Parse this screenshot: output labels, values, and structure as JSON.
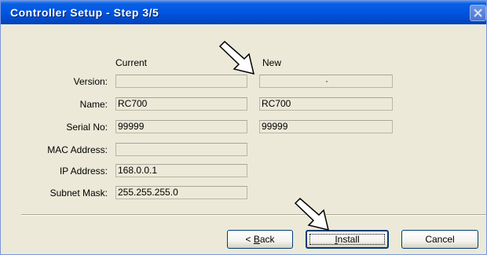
{
  "window": {
    "title": "Controller Setup - Step 3/5"
  },
  "headers": {
    "current": "Current",
    "new": "New"
  },
  "rows": [
    {
      "label": "Version:",
      "current": "",
      "new": "·"
    },
    {
      "label": "Name:",
      "current": "RC700",
      "new": "RC700"
    },
    {
      "label": "Serial No:",
      "current": "99999",
      "new": "99999"
    },
    {
      "label": "MAC Address:",
      "current": ""
    },
    {
      "label": "IP Address:",
      "current": "168.0.0.1"
    },
    {
      "label": "Subnet Mask:",
      "current": "255.255.255.0"
    }
  ],
  "buttons": {
    "back_prefix": "< ",
    "back_mnemonic": "B",
    "back_rest": "ack",
    "install_mnemonic": "I",
    "install_rest": "nstall",
    "cancel": "Cancel"
  },
  "icons": {
    "close": "close-icon",
    "annotation": "arrow-pointer-icon"
  }
}
